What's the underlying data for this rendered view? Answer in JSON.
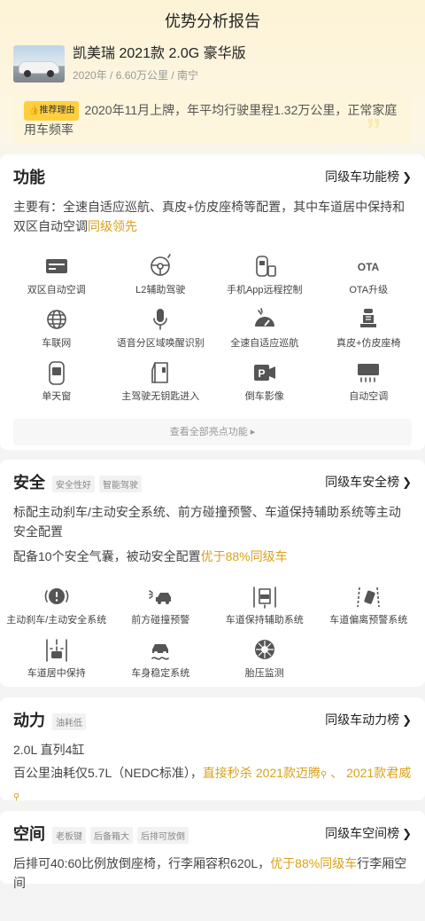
{
  "header": {
    "title": "优势分析报告"
  },
  "car": {
    "name": "凯美瑞 2021款 2.0G 豪华版",
    "meta": "2020年 / 6.60万公里 / 南宁"
  },
  "reason": {
    "tag": "推荐理由",
    "text": "2020年11月上牌，年平均行驶里程1.32万公里，正常家庭用车频率"
  },
  "function": {
    "title": "功能",
    "rank_label": "同级车功能榜",
    "desc_main": "主要有：全速自适应巡航、真皮+仿皮座椅等配置，其中车道居中保持和双区自动空调",
    "desc_highlight": "同级领先",
    "features": [
      {
        "label": "双区自动空调",
        "icon": "ac-panel-icon"
      },
      {
        "label": "L2辅助驾驶",
        "icon": "steering-wheel-icon"
      },
      {
        "label": "手机App远程控制",
        "icon": "remote-car-icon"
      },
      {
        "label": "OTA升级",
        "icon": "ota-icon",
        "glyph": "OTA"
      },
      {
        "label": "车联网",
        "icon": "globe-icon"
      },
      {
        "label": "语音分区域唤醒识别",
        "icon": "microphone-icon"
      },
      {
        "label": "全速自适应巡航",
        "icon": "gauge-icon"
      },
      {
        "label": "真皮+仿皮座椅",
        "icon": "seat-icon"
      },
      {
        "label": "单天窗",
        "icon": "sunroof-icon"
      },
      {
        "label": "主驾驶无钥匙进入",
        "icon": "door-icon"
      },
      {
        "label": "倒车影像",
        "icon": "parking-camera-icon"
      },
      {
        "label": "自动空调",
        "icon": "ac-vent-icon"
      }
    ],
    "view_all": "查看全部亮点功能"
  },
  "safety": {
    "title": "安全",
    "tags": [
      "安全性好",
      "智能驾驶"
    ],
    "rank_label": "同级车安全榜",
    "desc1": "标配主动刹车/主动安全系统、前方碰撞预警、车道保持辅助系统等主动安全配置",
    "desc2_main": "配备10个安全气囊，被动安全配置",
    "desc2_highlight": "优于88%同级车",
    "features": [
      {
        "label": "主动刹车/主动安全系统",
        "icon": "brake-icon"
      },
      {
        "label": "前方碰撞预警",
        "icon": "collision-warning-icon"
      },
      {
        "label": "车道保持辅助系统",
        "icon": "lane-keep-icon"
      },
      {
        "label": "车道偏离预警系统",
        "icon": "lane-departure-icon"
      },
      {
        "label": "车道居中保持",
        "icon": "lane-center-icon"
      },
      {
        "label": "车身稳定系统",
        "icon": "stability-icon"
      },
      {
        "label": "胎压监测",
        "icon": "tire-pressure-icon"
      }
    ]
  },
  "power": {
    "title": "动力",
    "tags": [
      "油耗低"
    ],
    "rank_label": "同级车动力榜",
    "engine": "2.0L 直列4缸",
    "fuel_main": "百公里油耗仅5.7L（NEDC标准），",
    "fuel_highlight": "直接秒杀",
    "link1": "2021款迈腾",
    "sep": "、",
    "link2": "2021款君威"
  },
  "space": {
    "title": "空间",
    "tags": [
      "老板键",
      "后备箱大",
      "后排可放倒"
    ],
    "rank_label": "同级车空间榜",
    "desc_main": "后排可40:60比例放倒座椅，行李厢容积620L，",
    "desc_highlight": "优于88%同级车",
    "desc_tail": "行李厢空间"
  },
  "colors": {
    "accent": "#d9a11a",
    "tag_yellow": "#ffcf40",
    "icon": "#555555"
  }
}
